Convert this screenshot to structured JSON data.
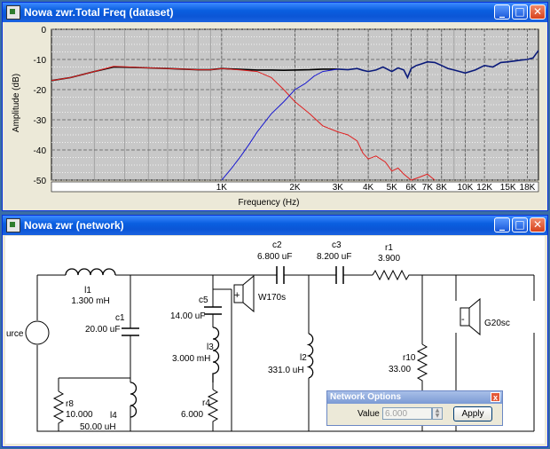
{
  "windows": {
    "freq": {
      "title": "Nowa zwr.Total Freq (dataset)",
      "controls": {
        "minimize": "_",
        "maximize": "□",
        "close": "✕"
      }
    },
    "net": {
      "title": "Nowa zwr (network)",
      "controls": {
        "minimize": "_",
        "maximize": "□",
        "close": "✕"
      }
    }
  },
  "chart_data": {
    "type": "line",
    "xlabel": "Frequency (Hz)",
    "ylabel": "Amplitude (dB)",
    "x_scale": "log",
    "xlim": [
      200,
      20000
    ],
    "ylim": [
      -50,
      0
    ],
    "yticks": [
      0,
      -10,
      -20,
      -30,
      -40,
      -50
    ],
    "xticks": [
      {
        "value": 1000,
        "label": "1K"
      },
      {
        "value": 2000,
        "label": "2K"
      },
      {
        "value": 3000,
        "label": "3K"
      },
      {
        "value": 4000,
        "label": "4K"
      },
      {
        "value": 5000,
        "label": "5K"
      },
      {
        "value": 6000,
        "label": "6K"
      },
      {
        "value": 7000,
        "label": "7K"
      },
      {
        "value": 8000,
        "label": "8K"
      },
      {
        "value": 10000,
        "label": "10K"
      },
      {
        "value": 12000,
        "label": "12K"
      },
      {
        "value": 15000,
        "label": "15K"
      },
      {
        "value": 18000,
        "label": "18K"
      }
    ],
    "grid": true,
    "colors": {
      "black": "#000000",
      "red": "#e02020",
      "blue": "#1a1ad0",
      "navy": "#0a1a7a",
      "plot_bg": "#c8c8c8",
      "grid": "#9a9a9a"
    },
    "series": [
      {
        "color": "black",
        "x": [
          200,
          240,
          300,
          360,
          420,
          500,
          600,
          700,
          800,
          900,
          1000,
          1200,
          1400,
          1600,
          1800,
          2000,
          2300,
          2600,
          3000
        ],
        "y": [
          -17,
          -16,
          -14,
          -12.5,
          -12.6,
          -12.8,
          -13,
          -13.2,
          -13.4,
          -13.4,
          -13,
          -13.3,
          -13.5,
          -13.5,
          -13.6,
          -13.5,
          -13.4,
          -13.2,
          -13.2
        ]
      },
      {
        "color": "red",
        "x": [
          200,
          240,
          300,
          360,
          420,
          500,
          600,
          700,
          800,
          900,
          1000,
          1200,
          1400,
          1600,
          1800,
          2000,
          2300,
          2600,
          3000,
          3300,
          3600,
          3800,
          4000,
          4300,
          4700,
          5000,
          5300,
          5600,
          6000,
          6500,
          7000,
          7500
        ],
        "y": [
          -17,
          -16,
          -14,
          -12.3,
          -12.5,
          -12.8,
          -13,
          -13.2,
          -13.4,
          -13.4,
          -13,
          -13.5,
          -14,
          -16,
          -20,
          -24,
          -28,
          -32,
          -34,
          -35,
          -37,
          -41,
          -43,
          -42,
          -44,
          -47,
          -46,
          -48,
          -50,
          -49,
          -48,
          -50
        ]
      },
      {
        "color": "blue",
        "x": [
          1000,
          1100,
          1200,
          1300,
          1400,
          1600,
          1800,
          2000,
          2200,
          2400,
          2600,
          3000
        ],
        "y": [
          -50,
          -46,
          -42,
          -38,
          -34,
          -28,
          -24,
          -20,
          -18,
          -15.5,
          -14,
          -13.2
        ]
      },
      {
        "color": "navy",
        "x": [
          3000,
          3300,
          3600,
          3800,
          4000,
          4300,
          4600,
          5000,
          5300,
          5600,
          5800,
          6000,
          6300,
          6600,
          7000,
          7500,
          8000,
          8500,
          9000,
          9500,
          10000,
          11000,
          12000,
          13000,
          14000,
          15000,
          16000,
          17000,
          18000,
          19000,
          20000
        ],
        "y": [
          -13.2,
          -13.4,
          -13,
          -13.6,
          -14,
          -13.5,
          -12.5,
          -14,
          -12.8,
          -13.5,
          -16,
          -13,
          -12,
          -11.5,
          -10.8,
          -11,
          -12,
          -13,
          -13.5,
          -14,
          -14.5,
          -13.5,
          -12,
          -12.5,
          -11,
          -10.8,
          -10.5,
          -10.2,
          -10,
          -9.5,
          -7
        ]
      }
    ]
  },
  "schematic": {
    "components": {
      "l1": {
        "name": "l1",
        "value": "1.300 mH"
      },
      "c1": {
        "name": "c1",
        "value": "20.00 uF"
      },
      "r8": {
        "name": "r8",
        "value": "10.000"
      },
      "l4": {
        "name": "l4",
        "value": "50.00 uH"
      },
      "c5": {
        "name": "c5",
        "value": "14.00 uF"
      },
      "l3": {
        "name": "l3",
        "value": "3.000 mH"
      },
      "r4": {
        "name": "r4",
        "value": "6.000"
      },
      "w170": {
        "name": "W170s",
        "plus": "+"
      },
      "c2": {
        "name": "c2",
        "value": "6.800 uF"
      },
      "c3": {
        "name": "c3",
        "value": "8.200 uF"
      },
      "r1": {
        "name": "r1",
        "value": "3.900"
      },
      "l2": {
        "name": "l2",
        "value": "331.0 uH"
      },
      "r10": {
        "name": "r10",
        "value": "33.00"
      },
      "g20": {
        "name": "G20sc",
        "minus": "-"
      },
      "source": {
        "name": "urce"
      }
    }
  },
  "network_options": {
    "title": "Network Options",
    "close": "x",
    "value_label": "Value",
    "value": "6.000",
    "apply_label": "Apply"
  }
}
